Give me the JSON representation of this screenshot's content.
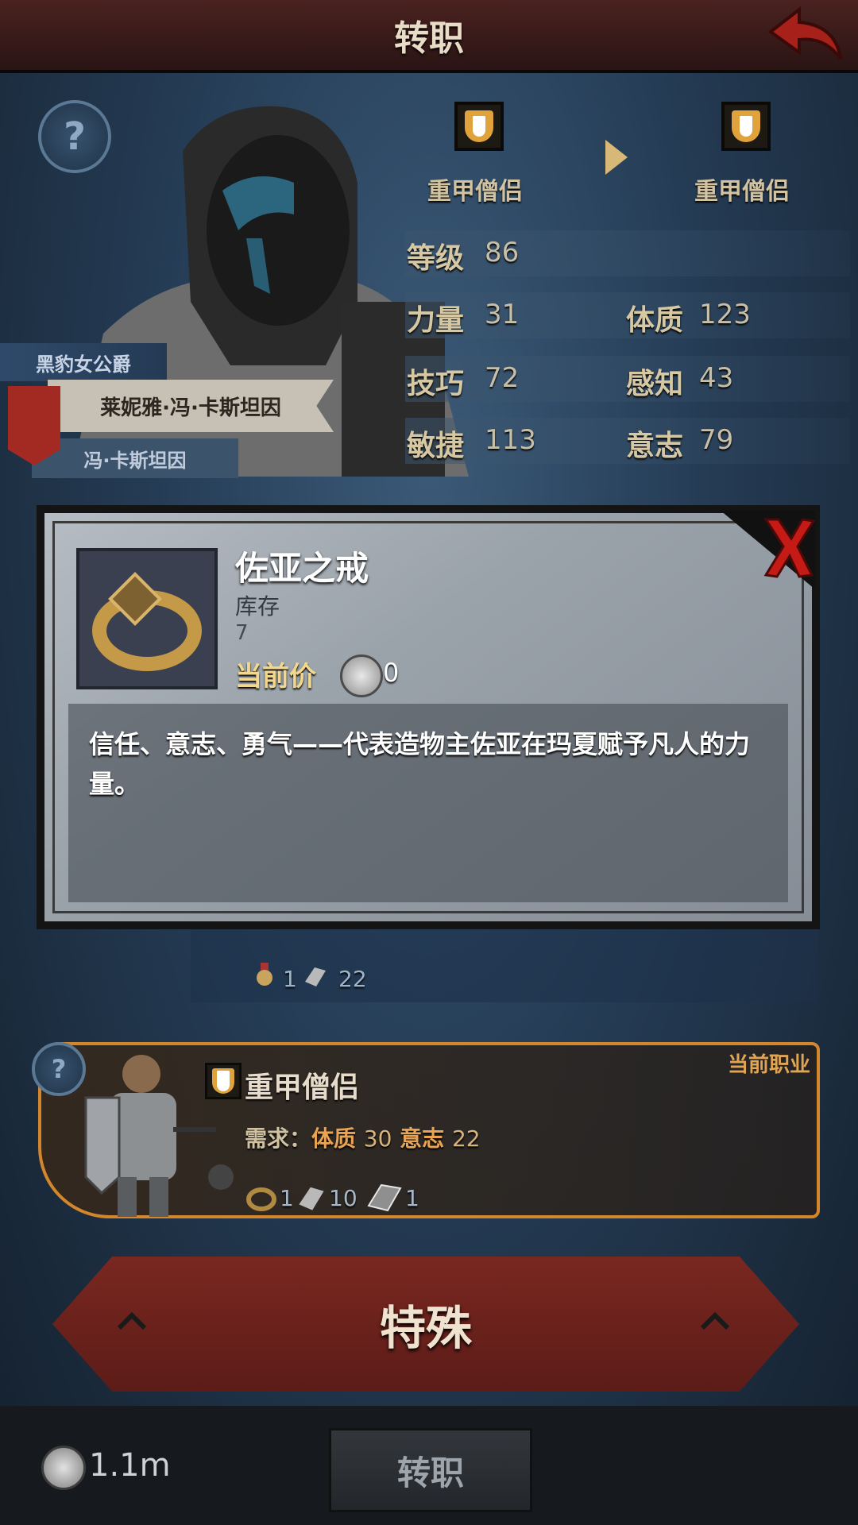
{
  "header": {
    "title": "转职"
  },
  "hero": {
    "honor_title": "黑豹女公爵",
    "full_name": "莱妮雅·冯·卡斯坦因",
    "family_name": "冯·卡斯坦因",
    "from_class": "重甲僧侣",
    "to_class": "重甲僧侣"
  },
  "stats": {
    "level_label": "等级",
    "level": "86",
    "strength_label": "力量",
    "strength": "31",
    "constitution_label": "体质",
    "constitution": "123",
    "skill_label": "技巧",
    "skill": "72",
    "perception_label": "感知",
    "perception": "43",
    "agility_label": "敏捷",
    "agility": "113",
    "will_label": "意志",
    "will": "79"
  },
  "popup": {
    "item_name": "佐亚之戒",
    "stock_label": "库存",
    "stock_value": "7",
    "price_label": "当前价",
    "price_value": "0",
    "description": "信任、意志、勇气——代表造物主佐亚在玛夏赋予凡人的力量。"
  },
  "hidden_row": {
    "medal_count": "1",
    "ingot_count": "22"
  },
  "current_class": {
    "tag": "当前职业",
    "name": "重甲僧侣",
    "req_prefix": "需求：",
    "req_1_label": "体质",
    "req_1_value": "30",
    "req_2_label": "意志",
    "req_2_value": "22",
    "ring_count": "1",
    "ingot_count": "10",
    "bar_count": "1"
  },
  "special_button": {
    "label": "特殊"
  },
  "footer": {
    "silver": "1.1m",
    "job_button": "转职"
  },
  "colors": {
    "accent": "#d3862c",
    "banner_red": "#7a2720",
    "gold_text": "#f2d78c"
  },
  "icons": [
    "back-arrow-icon",
    "help-icon",
    "shield-class-icon",
    "ring-icon",
    "coin-icon",
    "close-icon",
    "medal-icon",
    "ingot-icon",
    "iron-bar-icon"
  ]
}
